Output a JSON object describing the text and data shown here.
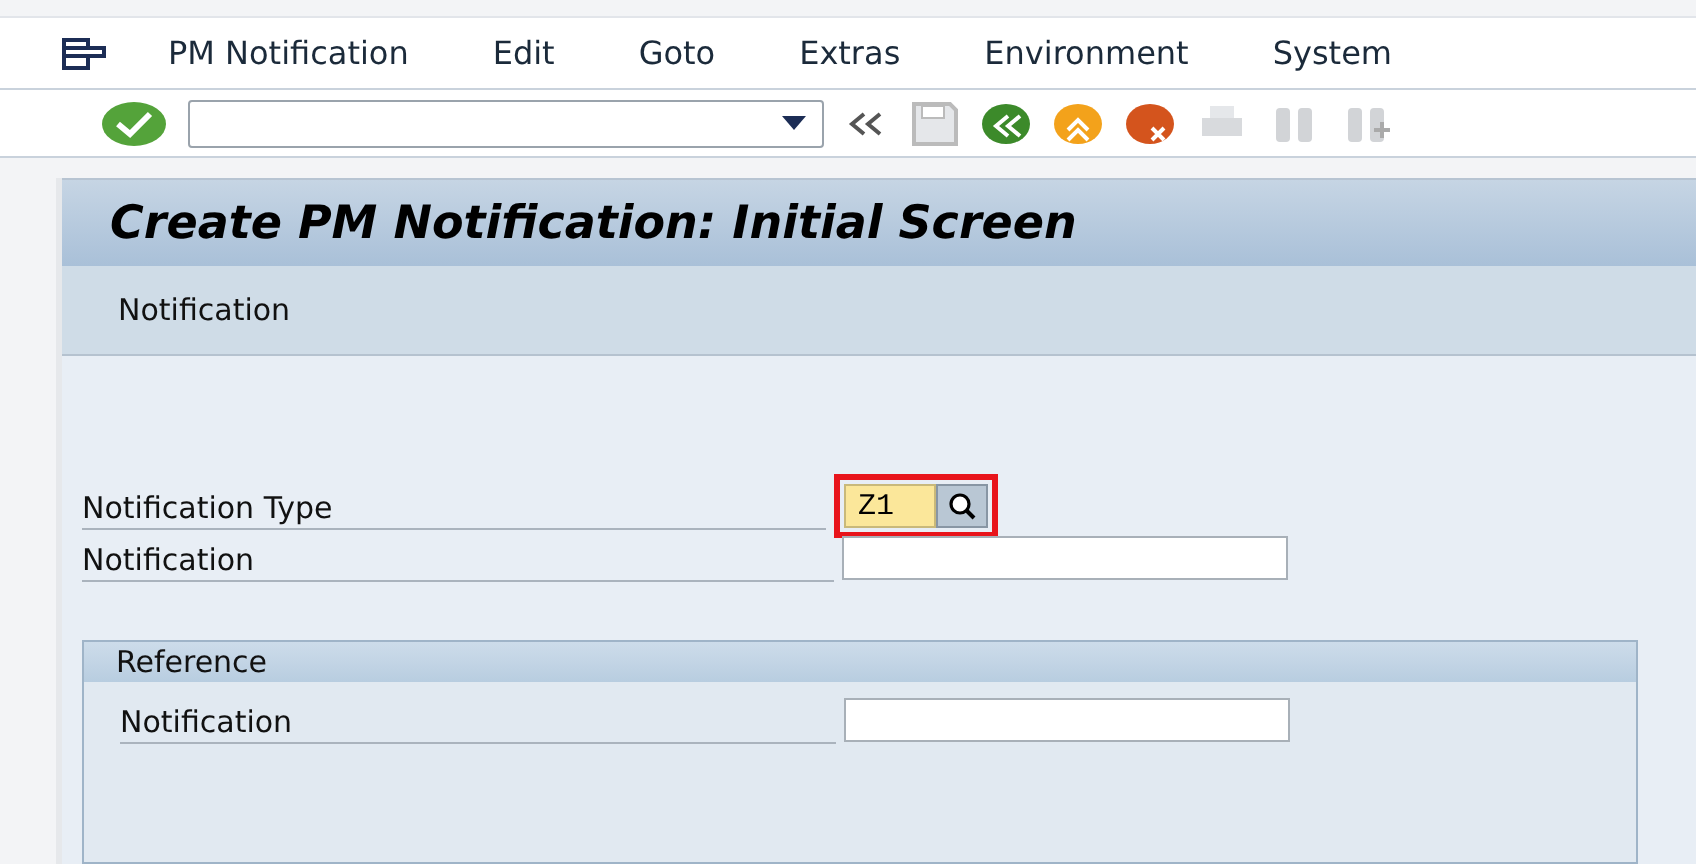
{
  "menu": [
    "PM Notification",
    "Edit",
    "Goto",
    "Extras",
    "Environment",
    "System"
  ],
  "title": "Create PM Notification: Initial Screen",
  "application_toolbar": [
    "Notification"
  ],
  "fields": [
    {
      "label": "Notification Type",
      "value": "Z1",
      "kind": "required",
      "highlighted": true
    },
    {
      "label": "Notification",
      "kind": "input",
      "highlighted": false
    }
  ],
  "group": {
    "title": "Reference",
    "fields": [
      {
        "label": "Notification",
        "kind": "input",
        "highlighted": false
      }
    ]
  }
}
